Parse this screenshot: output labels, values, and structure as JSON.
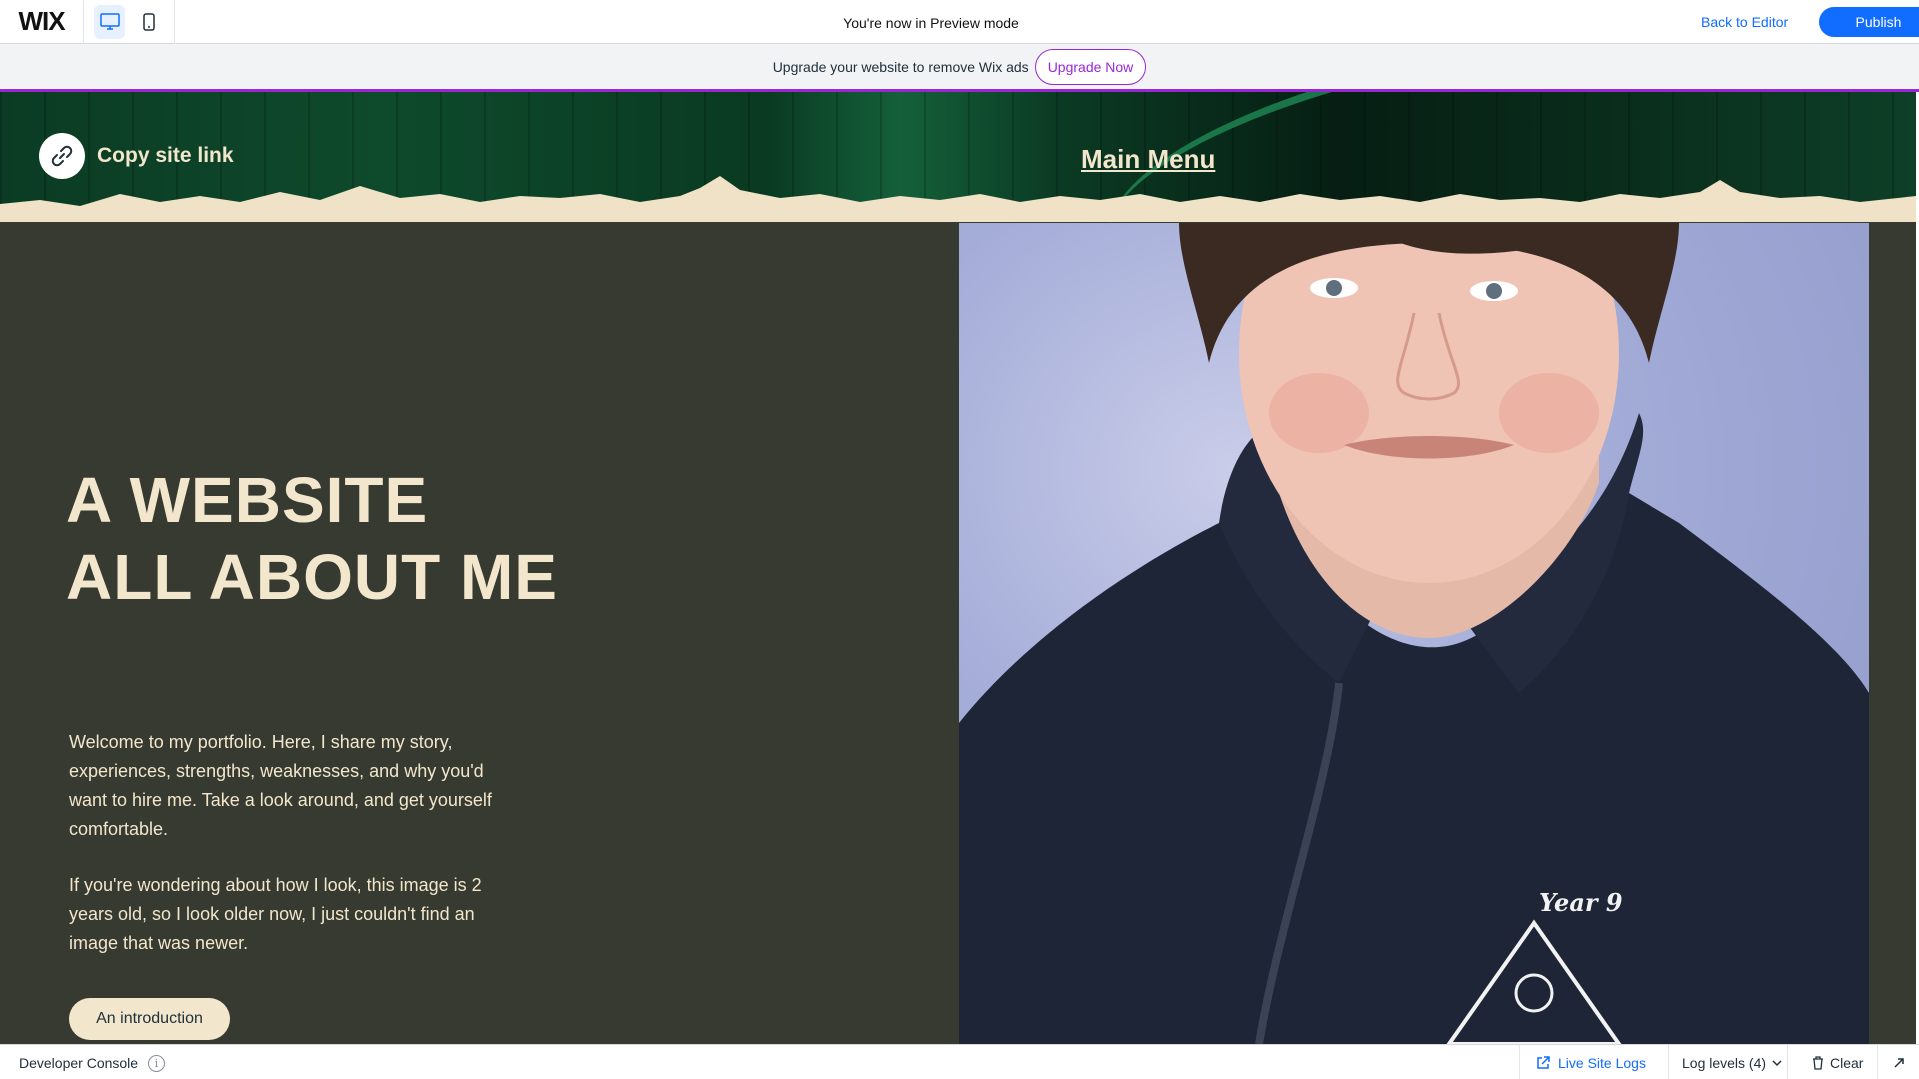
{
  "topbar": {
    "logo": "WIX",
    "preview_mode_text": "You're now in Preview mode",
    "back_to_editor": "Back to Editor",
    "publish": "Publish"
  },
  "upgrade_bar": {
    "text": "Upgrade your website to remove Wix ads",
    "button": "Upgrade Now"
  },
  "site": {
    "header": {
      "copy_link": "Copy site link",
      "main_menu": "Main Menu"
    },
    "hero": {
      "title": "A WEBSITE ALL ABOUT ME",
      "paragraph1": "Welcome to my portfolio. Here, I share my story, experiences, strengths, weaknesses, and why you'd want to hire me. Take a look around, and get yourself comfortable.",
      "paragraph2": "If you're wondering about how I look, this image is 2 years old, so I look older now, I just couldn't find an image that was newer.",
      "button": "An introduction"
    },
    "photo": {
      "jacket_text": "Year 9"
    }
  },
  "console": {
    "title": "Developer Console",
    "live_site_logs": "Live Site Logs",
    "log_levels": "Log levels (4)",
    "clear": "Clear"
  },
  "colors": {
    "accent_blue": "#116dff",
    "upgrade_purple": "#9a27d5",
    "site_bg": "#373a30",
    "cream": "#f2e6cc",
    "header_green": "#0b3b24"
  }
}
